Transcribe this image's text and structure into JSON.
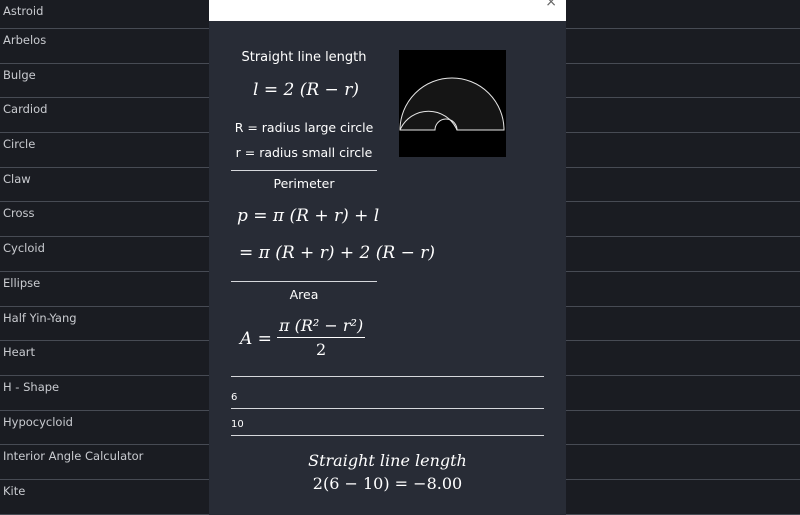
{
  "sidebar": {
    "items": [
      {
        "label": "Astroid"
      },
      {
        "label": "Arbelos"
      },
      {
        "label": "Bulge"
      },
      {
        "label": "Cardiod"
      },
      {
        "label": "Circle"
      },
      {
        "label": "Claw"
      },
      {
        "label": "Cross"
      },
      {
        "label": "Cycloid"
      },
      {
        "label": "Ellipse"
      },
      {
        "label": "Half Yin-Yang"
      },
      {
        "label": "Heart"
      },
      {
        "label": "H - Shape"
      },
      {
        "label": "Hypocycloid"
      },
      {
        "label": "Interior Angle Calculator"
      },
      {
        "label": "Kite"
      }
    ]
  },
  "modal": {
    "close_label": "×",
    "straight_line": {
      "title": "Straight line length",
      "formula": "l = 2 (R − r)",
      "def_R": "R = radius large circle",
      "def_r": "r = radius small circle"
    },
    "perimeter": {
      "title": "Perimeter",
      "formula_1": "p = π (R + r) + l",
      "formula_2": "= π (R + r) + 2 (R − r)"
    },
    "area": {
      "title": "Area",
      "lhs": "A =",
      "numerator": "π (R² − r²)",
      "denominator": "2"
    },
    "inputs": {
      "r_value": "6",
      "R_value": "10"
    },
    "result": {
      "title": "Straight line length",
      "equation": "2(6 − 10)  = −8.00"
    }
  },
  "colors": {
    "background": "#1a1c22",
    "modal_bg": "#282c36",
    "text": "#ffffff",
    "divider": "#474b54"
  }
}
